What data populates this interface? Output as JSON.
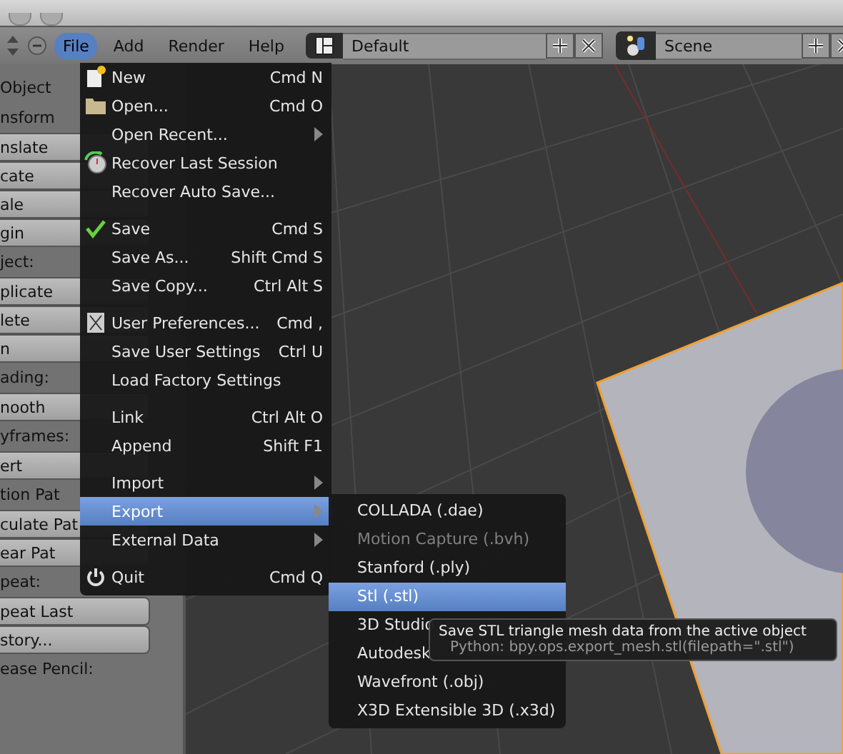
{
  "header": {
    "menus": [
      {
        "label": "File",
        "selected": true
      },
      {
        "label": "Add",
        "selected": false
      },
      {
        "label": "Render",
        "selected": false
      },
      {
        "label": "Help",
        "selected": false
      }
    ],
    "layout": {
      "value": "Default"
    },
    "scene": {
      "value": "Scene"
    }
  },
  "tool_panel": {
    "items": [
      {
        "kind": "heading",
        "label": "Object"
      },
      {
        "kind": "heading",
        "label": "nsform"
      },
      {
        "kind": "button",
        "label": "nslate"
      },
      {
        "kind": "button",
        "label": "cate"
      },
      {
        "kind": "button",
        "label": "ale"
      },
      {
        "kind": "button",
        "label": "gin"
      },
      {
        "kind": "heading",
        "label": "ject:"
      },
      {
        "kind": "button",
        "label": "plicate"
      },
      {
        "kind": "button",
        "label": "lete"
      },
      {
        "kind": "button",
        "label": "n"
      },
      {
        "kind": "heading",
        "label": "ading:"
      },
      {
        "kind": "button",
        "label": "nooth"
      },
      {
        "kind": "heading",
        "label": "yframes:"
      },
      {
        "kind": "button",
        "label": "ert"
      },
      {
        "kind": "heading",
        "label": "tion Pat"
      },
      {
        "kind": "button",
        "label": "culate Pat"
      },
      {
        "kind": "button",
        "label": "ear Pat"
      },
      {
        "kind": "heading",
        "label": "peat:"
      },
      {
        "kind": "button",
        "label": "peat Last"
      },
      {
        "kind": "button",
        "label": "story..."
      },
      {
        "kind": "heading",
        "label": "ease Pencil:"
      }
    ]
  },
  "file_menu": {
    "groups": [
      [
        {
          "kind": "document",
          "label": "New",
          "shortcut": "Cmd N",
          "submenu": false,
          "selected": false,
          "checked": false
        },
        {
          "kind": "folder",
          "label": "Open...",
          "shortcut": "Cmd O",
          "submenu": false,
          "selected": false,
          "checked": false
        },
        {
          "kind": "plain",
          "label": "Open Recent...",
          "submenu": true,
          "selected": false,
          "checked": false
        },
        {
          "kind": "recover",
          "label": "Recover Last Session",
          "submenu": false,
          "selected": false,
          "checked": false
        },
        {
          "kind": "plain",
          "label": "Recover Auto Save...",
          "submenu": false,
          "selected": false,
          "checked": false
        }
      ],
      [
        {
          "kind": "plain",
          "label": "Save",
          "shortcut": "Cmd S",
          "submenu": false,
          "selected": false,
          "checked": true
        },
        {
          "kind": "plain",
          "label": "Save As...",
          "shortcut": "Shift Cmd S",
          "submenu": false,
          "selected": false,
          "checked": false
        },
        {
          "kind": "plain",
          "label": "Save Copy...",
          "shortcut": "Ctrl Alt S",
          "submenu": false,
          "selected": false,
          "checked": false
        }
      ],
      [
        {
          "kind": "preferences",
          "label": "User Preferences...",
          "shortcut": "Cmd ,",
          "submenu": false,
          "selected": false,
          "checked": false
        },
        {
          "kind": "plain",
          "label": "Save User Settings",
          "shortcut": "Ctrl U",
          "submenu": false,
          "selected": false,
          "checked": false
        },
        {
          "kind": "plain",
          "label": "Load Factory Settings",
          "submenu": false,
          "selected": false,
          "checked": false
        }
      ],
      [
        {
          "kind": "plain",
          "label": "Link",
          "shortcut": "Ctrl Alt O",
          "submenu": false,
          "selected": false,
          "checked": false
        },
        {
          "kind": "plain",
          "label": "Append",
          "shortcut": "Shift F1",
          "submenu": false,
          "selected": false,
          "checked": false
        }
      ],
      [
        {
          "kind": "plain",
          "label": "Import",
          "submenu": true,
          "selected": false,
          "checked": false
        },
        {
          "kind": "plain",
          "label": "Export",
          "submenu": true,
          "selected": true,
          "checked": false
        },
        {
          "kind": "plain",
          "label": "External Data",
          "submenu": true,
          "selected": false,
          "checked": false
        }
      ],
      [
        {
          "kind": "power",
          "label": "Quit",
          "shortcut": "Cmd Q",
          "submenu": false,
          "selected": false,
          "checked": false
        }
      ]
    ]
  },
  "export_menu": {
    "items": [
      {
        "label": "COLLADA (.dae)",
        "selected": false,
        "disabled": false
      },
      {
        "label": "Motion Capture (.bvh)",
        "selected": false,
        "disabled": true
      },
      {
        "label": "Stanford (.ply)",
        "selected": false,
        "disabled": false
      },
      {
        "label": "Stl (.stl)",
        "selected": true,
        "disabled": false
      },
      {
        "label": "3D Studio",
        "selected": false,
        "disabled": false
      },
      {
        "label": "Autodesk",
        "selected": false,
        "disabled": false
      },
      {
        "label": "Wavefront (.obj)",
        "selected": false,
        "disabled": false
      },
      {
        "label": "X3D Extensible 3D (.x3d)",
        "selected": false,
        "disabled": false
      }
    ]
  },
  "tooltip": {
    "description": "Save STL triangle mesh data from the active object",
    "python": "Python: bpy.ops.export_mesh.stl(filepath=\".stl\")"
  }
}
